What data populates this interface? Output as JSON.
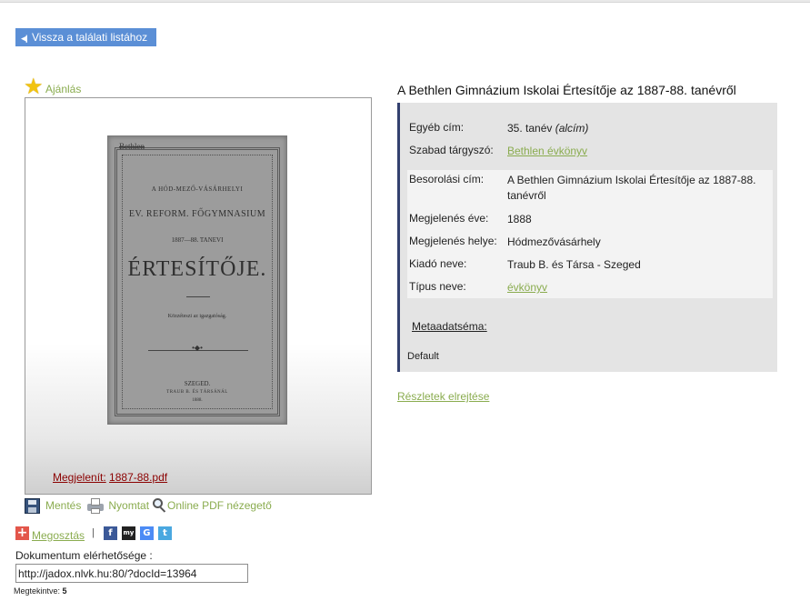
{
  "nav": {
    "back_label": "Vissza a találati listához"
  },
  "left": {
    "recommend_label": "Ajánlás",
    "cover": {
      "stamp": "Bethlen",
      "line1": "A HÓD-MEZŐ-VÁSÁRHELYI",
      "line2": "EV. REFORM. FŐGYMNASIUM",
      "line3": "1887—88. TANEVI",
      "line4": "ÉRTESÍTŐJE.",
      "line5": "Közzéteszi az igazgatóság.",
      "line6": "SZEGED.",
      "line7": "TRAUB B. ÉS TÁRSÁNÁL",
      "line8": "1888."
    },
    "display_label": "Megjelenít:",
    "display_file": "1887-88.pdf",
    "tools": {
      "save": "Mentés",
      "print": "Nyomtat",
      "pdf_viewer": "Online PDF nézegető"
    },
    "share_label": "Megosztás",
    "share_separator": "|",
    "social": [
      "f",
      "my",
      "G",
      "t"
    ],
    "availability_label": "Dokumentum elérhetősége :",
    "availability_url": "http://jadox.nlvk.hu:80/?docId=13964",
    "views_label": "Megtekintve:",
    "views_count": "5"
  },
  "record": {
    "title": "A Bethlen Gimnázium Iskolai Értesítője az 1887-88. tanévről",
    "fields": [
      {
        "key": "Egyéb cím:",
        "value": "35. tanév",
        "suffix": "(alcím)"
      },
      {
        "key": "Szabad tárgyszó:",
        "value": "Bethlen évkönyv"
      },
      {
        "key": "Besorolási cím:",
        "value": "A Bethlen Gimnázium Iskolai Értesítője az 1887-88. tanévről"
      },
      {
        "key": "Megjelenés éve:",
        "value": "1888"
      },
      {
        "key": "Megjelenés helye:",
        "value": "Hódmezővásárhely"
      },
      {
        "key": "Kiadó neve:",
        "value": "Traub B. és Társa - Szeged"
      },
      {
        "key": "Típus neve:",
        "value": "évkönyv"
      }
    ],
    "schema_label": "Metaadatséma:",
    "schema_value": "Default",
    "hide_details": "Részletek elrejtése"
  },
  "colors": {
    "accent_green": "#8aac4f",
    "button_blue": "#5b8fd6",
    "border_navy": "#33406f",
    "link_red": "#8b0000"
  }
}
